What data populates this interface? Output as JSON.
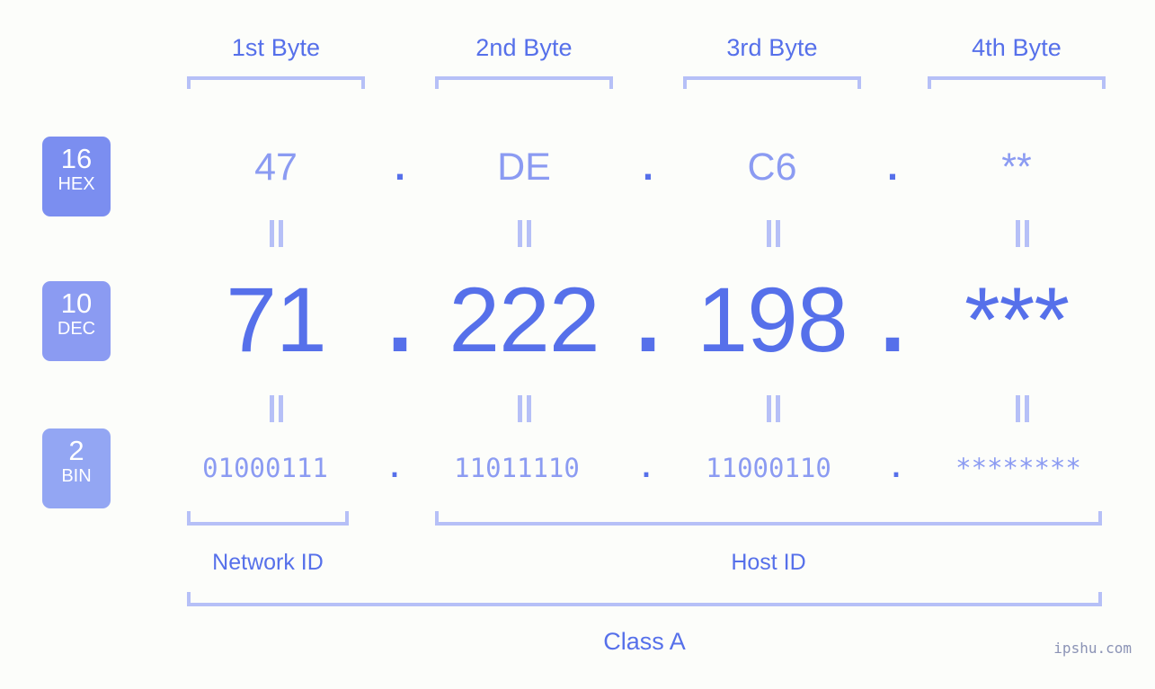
{
  "meta": {
    "watermark": "ipshu.com"
  },
  "headers": {
    "byte_labels": [
      "1st Byte",
      "2nd Byte",
      "3rd Byte",
      "4th Byte"
    ]
  },
  "bases": [
    {
      "number": "16",
      "name": "HEX",
      "color": "#7b8ef0"
    },
    {
      "number": "10",
      "name": "DEC",
      "color": "#8b9bf2"
    },
    {
      "number": "2",
      "name": "BIN",
      "color": "#93a6f3"
    }
  ],
  "separator": ".",
  "rows": {
    "hex": {
      "base_number": "16",
      "base_name": "HEX",
      "values": [
        "47",
        "DE",
        "C6",
        "**"
      ]
    },
    "dec": {
      "base_number": "10",
      "base_name": "DEC",
      "values": [
        "71",
        "222",
        "198",
        "***"
      ]
    },
    "bin": {
      "base_number": "2",
      "base_name": "BIN",
      "values": [
        "01000111",
        "11011110",
        "11000110",
        "********"
      ]
    }
  },
  "sections": {
    "network_id": "Network ID",
    "host_id": "Host ID",
    "class": "Class A"
  },
  "colors": {
    "background": "#fcfdfa",
    "accent_dark": "#5670ea",
    "accent_mid": "#8b9bf2",
    "accent_light": "#b6c0f7",
    "badge_hex": "#7b8ef0",
    "badge_dec": "#8b9bf2",
    "badge_bin": "#93a6f3",
    "watermark": "#8b93b5"
  }
}
